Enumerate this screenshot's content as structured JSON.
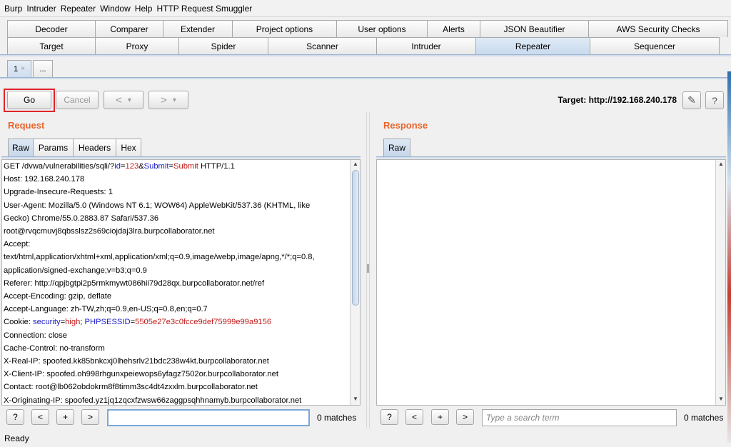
{
  "menu": [
    "Burp",
    "Intruder",
    "Repeater",
    "Window",
    "Help",
    "HTTP Request Smuggler"
  ],
  "tabs_top": [
    "Decoder",
    "Comparer",
    "Extender",
    "Project options",
    "User options",
    "Alerts",
    "JSON Beautifier",
    "AWS Security Checks"
  ],
  "tabs_main": [
    "Target",
    "Proxy",
    "Spider",
    "Scanner",
    "Intruder",
    "Repeater",
    "Sequencer"
  ],
  "active_main_tab": "Repeater",
  "repeater_tabs": {
    "tab1": "1",
    "tab1_close": "×",
    "more": "..."
  },
  "toolbar": {
    "go": "Go",
    "cancel": "Cancel",
    "back": "<",
    "back_menu": "▾",
    "forward": ">",
    "forward_menu": "▾",
    "target_text": "Target: http://192.168.240.178"
  },
  "request": {
    "title": "Request",
    "tabs": [
      "Raw",
      "Params",
      "Headers",
      "Hex"
    ],
    "line1": {
      "a": "GET /dvwa/vulnerabilities/sqli/?",
      "k1": "id",
      "eq1": "=",
      "v1": "123",
      "amp": "&",
      "k2": "Submit",
      "eq2": "=",
      "v2": "Submit",
      "end": " HTTP/1.1"
    },
    "lines_a": [
      "Host: 192.168.240.178",
      "Upgrade-Insecure-Requests: 1",
      "User-Agent: Mozilla/5.0 (Windows NT 6.1; WOW64) AppleWebKit/537.36 (KHTML, like",
      "Gecko) Chrome/55.0.2883.87 Safari/537.36",
      "root@rvqcmuvj8qbsslsz2s69ciojdaj3lra.burpcollaborator.net",
      "Accept:",
      "text/html,application/xhtml+xml,application/xml;q=0.9,image/webp,image/apng,*/*;q=0.8,",
      "application/signed-exchange;v=b3;q=0.9",
      "Referer: http://qpjbgtpi2p5rmkmywt086hii79d28qx.burpcollaborator.net/ref",
      "Accept-Encoding: gzip, deflate",
      "Accept-Language: zh-TW,zh;q=0.9,en-US;q=0.8,en;q=0.7"
    ],
    "cookie": {
      "a": "Cookie: ",
      "k1": "security",
      "eq1": "=",
      "v1": "high",
      "sep": "; ",
      "k2": "PHPSESSID",
      "eq2": "=",
      "v2": "5505e27e3c0fcce9def75999e99a9156"
    },
    "lines_b": [
      "Connection: close",
      "Cache-Control: no-transform",
      "X-Real-IP: spoofed.kk85bnkcxj0lhehsrlv21bdc238w4kt.burpcollaborator.net",
      "X-Client-IP: spoofed.oh998rhgunxpeiewops6yfagz7502or.burpcollaborator.net",
      "Contact: root@lb062obdokrm8f8timm3sc4dt4zxxlm.burpcollaborator.net",
      "X-Originating-IP: spoofed.yz1jq1zqcxfzwsw66zaggpsqhhnamyb.burpcollaborator.net"
    ],
    "search_value": "",
    "matches": "0 matches"
  },
  "response": {
    "title": "Response",
    "tab": "Raw",
    "search_placeholder": "Type a search term",
    "matches": "0 matches"
  },
  "search_buttons": {
    "help": "?",
    "prev": "<",
    "add": "+",
    "next": ">"
  },
  "icons": {
    "edit": "✎",
    "help": "?"
  },
  "status": "Ready"
}
